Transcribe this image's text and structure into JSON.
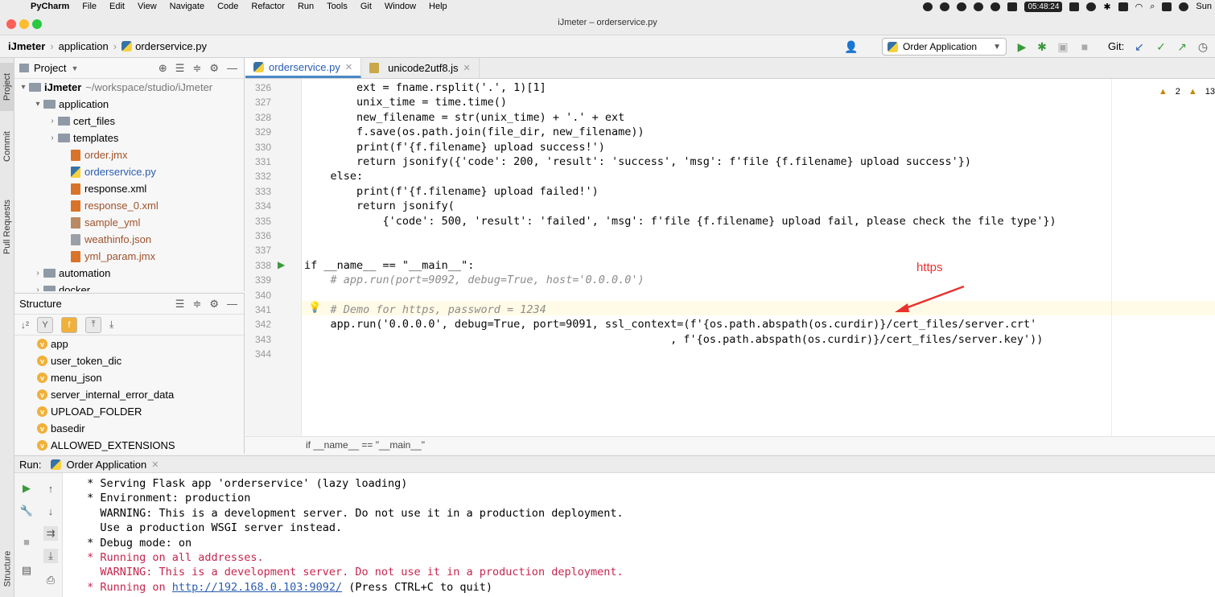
{
  "menubar": {
    "app_name": "PyCharm",
    "items": [
      "File",
      "Edit",
      "View",
      "Navigate",
      "Code",
      "Refactor",
      "Run",
      "Tools",
      "Git",
      "Window",
      "Help"
    ],
    "clock": "05:48:24",
    "right_text": "Sun"
  },
  "window": {
    "title": "iJmeter – orderservice.py"
  },
  "navbar": {
    "breadcrumbs": [
      "iJmeter",
      "application",
      "orderservice.py"
    ],
    "run_config": "Order Application",
    "git_label": "Git:"
  },
  "leftstrip": {
    "tabs": [
      "Project",
      "Commit",
      "Pull Requests",
      "Structure"
    ]
  },
  "project": {
    "header": "Project",
    "root_name": "iJmeter",
    "root_path": "~/workspace/studio/iJmeter",
    "rows": [
      {
        "label": "application",
        "kind": "folder",
        "expanded": true
      },
      {
        "label": "cert_files",
        "kind": "folder"
      },
      {
        "label": "templates",
        "kind": "folder"
      },
      {
        "label": "order.jmx",
        "kind": "xml",
        "color": "brown"
      },
      {
        "label": "orderservice.py",
        "kind": "py",
        "color": "blue"
      },
      {
        "label": "response.xml",
        "kind": "xml"
      },
      {
        "label": "response_0.xml",
        "kind": "xml",
        "color": "brown"
      },
      {
        "label": "sample_yml",
        "kind": "yml",
        "color": "brown"
      },
      {
        "label": "weathinfo.json",
        "kind": "json",
        "color": "brown"
      },
      {
        "label": "yml_param.jmx",
        "kind": "xml",
        "color": "brown"
      },
      {
        "label": "automation",
        "kind": "folder"
      },
      {
        "label": "docker",
        "kind": "folder"
      }
    ]
  },
  "structure": {
    "header": "Structure",
    "items": [
      "app",
      "user_token_dic",
      "menu_json",
      "server_internal_error_data",
      "UPLOAD_FOLDER",
      "basedir",
      "ALLOWED_EXTENSIONS"
    ]
  },
  "editor": {
    "tabs": [
      {
        "label": "orderservice.py",
        "active": true
      },
      {
        "label": "unicode2utf8.js",
        "active": false
      }
    ],
    "warnings": "2",
    "warnings2": "13",
    "lines": [
      {
        "n": "326",
        "text": "        ext = fname.rsplit('.', 1)[1]"
      },
      {
        "n": "327",
        "text": "        unix_time = time.time()"
      },
      {
        "n": "328",
        "text": "        new_filename = str(unix_time) + '.' + ext"
      },
      {
        "n": "329",
        "text": "        f.save(os.path.join(file_dir, new_filename))"
      },
      {
        "n": "330",
        "text": "        print(f'{f.filename} upload success!')"
      },
      {
        "n": "331",
        "text": "        return jsonify({'code': 200, 'result': 'success', 'msg': f'file {f.filename} upload success'})"
      },
      {
        "n": "332",
        "text": "    else:"
      },
      {
        "n": "333",
        "text": "        print(f'{f.filename} upload failed!')"
      },
      {
        "n": "334",
        "text": "        return jsonify("
      },
      {
        "n": "335",
        "text": "            {'code': 500, 'result': 'failed', 'msg': f'file {f.filename} upload fail, please check the file type'})"
      },
      {
        "n": "336",
        "text": ""
      },
      {
        "n": "337",
        "text": ""
      },
      {
        "n": "338",
        "text": "if __name__ == \"__main__\":"
      },
      {
        "n": "339",
        "text": "    # app.run(port=9092, debug=True, host='0.0.0.0')"
      },
      {
        "n": "340",
        "text": ""
      },
      {
        "n": "341",
        "text": "    # Demo for https, password = 1234"
      },
      {
        "n": "342",
        "text": "    app.run('0.0.0.0', debug=True, port=9091, ssl_context=(f'{os.path.abspath(os.curdir)}/cert_files/server.crt'"
      },
      {
        "n": "343",
        "text": "                                                        , f'{os.path.abspath(os.curdir)}/cert_files/server.key'))"
      },
      {
        "n": "344",
        "text": ""
      }
    ],
    "breadcrumb": "if __name__ == \"__main__\""
  },
  "annotation": {
    "text": "https",
    "color": "#e8322f"
  },
  "run": {
    "label": "Run:",
    "tab": "Order Application",
    "output": [
      {
        "text": " * Serving Flask app 'orderservice' (lazy loading)",
        "red": false
      },
      {
        "text": " * Environment: production",
        "red": false
      },
      {
        "text": "   WARNING: This is a development server. Do not use it in a production deployment.",
        "red": false
      },
      {
        "text": "   Use a production WSGI server instead.",
        "red": false
      },
      {
        "text": " * Debug mode: on",
        "red": false
      },
      {
        "text": " * Running on all addresses.",
        "red": true
      },
      {
        "text": "   WARNING: This is a development server. Do not use it in a production deployment.",
        "red": true
      },
      {
        "text": " * Running on ",
        "red": true,
        "link": "http://192.168.0.103:9092/",
        "suffix": " (Press CTRL+C to quit)"
      }
    ]
  },
  "colors": {
    "accent": "#2a5db0",
    "run_green": "#3a9a3a",
    "warning": "#c08a00"
  }
}
